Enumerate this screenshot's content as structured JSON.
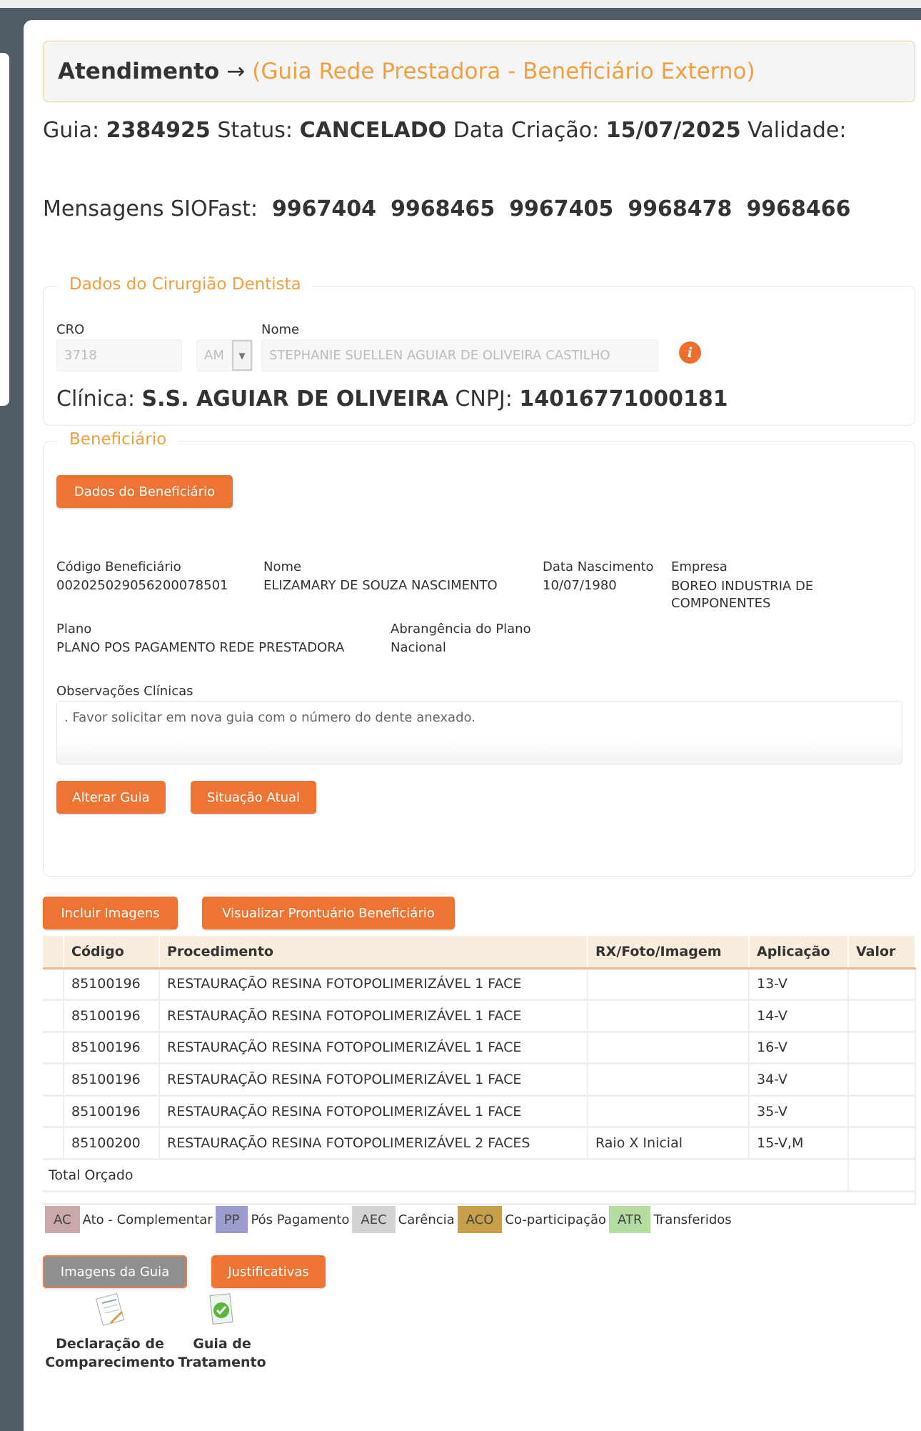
{
  "header": {
    "title": "Atendimento",
    "arrow": "→",
    "subtitle": "(Guia Rede Prestadora - Beneficiário Externo)"
  },
  "guia": {
    "guia_label": "Guia:",
    "guia": "2384925",
    "status_label": "Status:",
    "status": "CANCELADO",
    "criacao_label": "Data Criação:",
    "criacao": "15/07/2025",
    "validade_label": "Validade:"
  },
  "siofast": {
    "label": "Mensagens SIOFast:",
    "messages": [
      "9967404",
      "9968465",
      "9967405",
      "9968478",
      "9968466"
    ]
  },
  "dentista": {
    "legend": "Dados do Cirurgião Dentista",
    "cro_label": "CRO",
    "cro": "3718",
    "uf": "AM",
    "nome_label": "Nome",
    "nome": "STEPHANIE SUELLEN AGUIAR DE OLIVEIRA CASTILHO",
    "info_icon": "info-icon",
    "clinica_label": "Clínica:",
    "clinica": "S.S. AGUIAR DE OLIVEIRA",
    "cnpj_label": "CNPJ:",
    "cnpj": "14016771000181"
  },
  "beneficiario": {
    "legend": "Beneficiário",
    "dados_button": "Dados do Beneficiário",
    "codigo_label": "Código Beneficiário",
    "codigo": "002025029056200078501",
    "nome_label": "Nome",
    "nome": "ELIZAMARY DE SOUZA NASCIMENTO",
    "nasc_label": "Data Nascimento",
    "nasc": "10/07/1980",
    "empresa_label": "Empresa",
    "empresa": "BOREO INDUSTRIA DE COMPONENTES",
    "plano_label": "Plano",
    "plano": "PLANO POS PAGAMENTO REDE PRESTADORA",
    "abrang_label": "Abrangência do Plano",
    "abrang": "Nacional",
    "obs_label": "Observações Clínicas",
    "obs": ". Favor solicitar em nova guia com o número do dente anexado.",
    "alterar_button": "Alterar Guia",
    "situacao_button": "Situação Atual"
  },
  "actions": {
    "incluir": "Incluir Imagens",
    "visualizar": "Visualizar Prontuário Beneficiário"
  },
  "table": {
    "headers": [
      "",
      "Código",
      "Procedimento",
      "RX/Foto/Imagem",
      "Aplicação",
      "Valor"
    ],
    "rows": [
      [
        "85100196",
        "RESTAURAÇÃO RESINA FOTOPOLIMERIZÁVEL 1 FACE",
        "",
        "13-V"
      ],
      [
        "85100196",
        "RESTAURAÇÃO RESINA FOTOPOLIMERIZÁVEL 1 FACE",
        "",
        "14-V"
      ],
      [
        "85100196",
        "RESTAURAÇÃO RESINA FOTOPOLIMERIZÁVEL 1 FACE",
        "",
        "16-V"
      ],
      [
        "85100196",
        "RESTAURAÇÃO RESINA FOTOPOLIMERIZÁVEL 1 FACE",
        "",
        "34-V"
      ],
      [
        "85100196",
        "RESTAURAÇÃO RESINA FOTOPOLIMERIZÁVEL 1 FACE",
        "",
        "35-V"
      ],
      [
        "85100200",
        "RESTAURAÇÃO RESINA FOTOPOLIMERIZÁVEL 2 FACES",
        "Raio X Inicial",
        "15-V,M"
      ]
    ],
    "total_label": "Total Orçado"
  },
  "legend": [
    {
      "tag": "AC",
      "text": "Ato - Complementar",
      "color": "#c9a9a9"
    },
    {
      "tag": "PP",
      "text": "Pós Pagamento",
      "color": "#9c9ccf"
    },
    {
      "tag": "AEC",
      "text": "Carência",
      "color": "#d3d3d3"
    },
    {
      "tag": "ACO",
      "text": "Co-participação",
      "color": "#c8a04a"
    },
    {
      "tag": "ATR",
      "text": "Transferidos",
      "color": "#b5dca0"
    }
  ],
  "bottom": {
    "imagens": "Imagens da Guia",
    "justificativas": "Justificativas",
    "doc1_line1": "Declaração de",
    "doc1_line2": "Comparecimento",
    "doc2_line1": "Guia de",
    "doc2_line2": "Tratamento"
  }
}
